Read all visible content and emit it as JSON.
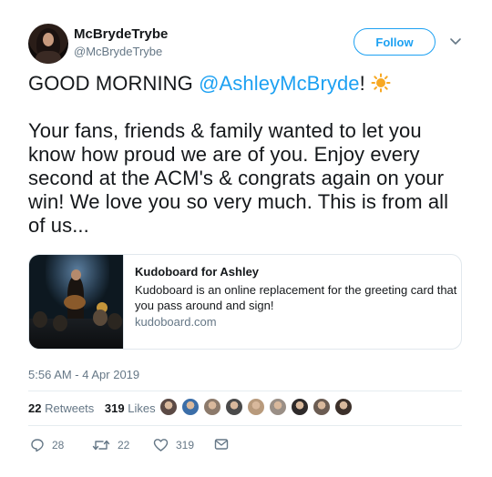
{
  "user": {
    "display_name": "McBrydeTrybe",
    "handle": "@McBrydeTrybe",
    "follow_label": "Follow"
  },
  "tweet": {
    "greeting": "GOOD MORNING ",
    "mention": "@AshleyMcBryde",
    "exclaim": "!",
    "body": "Your fans, friends & family wanted to let you know how proud we are of you. Enjoy every second at the ACM's & congrats again on your win! We love you so very much. This is from all of us..."
  },
  "card": {
    "title": "Kudoboard for Ashley",
    "description": "Kudoboard is an online replacement for the greeting card that you pass around and sign!",
    "domain": "kudoboard.com"
  },
  "timestamp": "5:56 AM - 4 Apr 2019",
  "stats": {
    "retweets_count": "22",
    "retweets_label": "Retweets",
    "likes_count": "319",
    "likes_label": "Likes"
  },
  "likers": [
    "#5b4a45",
    "#3b6ea8",
    "#8c7a6b",
    "#4a4a4a",
    "#b89a7c",
    "#9a8f86",
    "#2e2a2a",
    "#6b5c52",
    "#3c302a"
  ],
  "actions": {
    "reply_count": "28",
    "retweet_count": "22",
    "like_count": "319"
  },
  "colors": {
    "accent": "#1da1f2",
    "secondary_text": "#657786",
    "sun": "#f7a823"
  },
  "icons": [
    "chevron-down-icon",
    "sun-emoji-icon",
    "reply-icon",
    "retweet-icon",
    "heart-icon",
    "mail-icon"
  ]
}
